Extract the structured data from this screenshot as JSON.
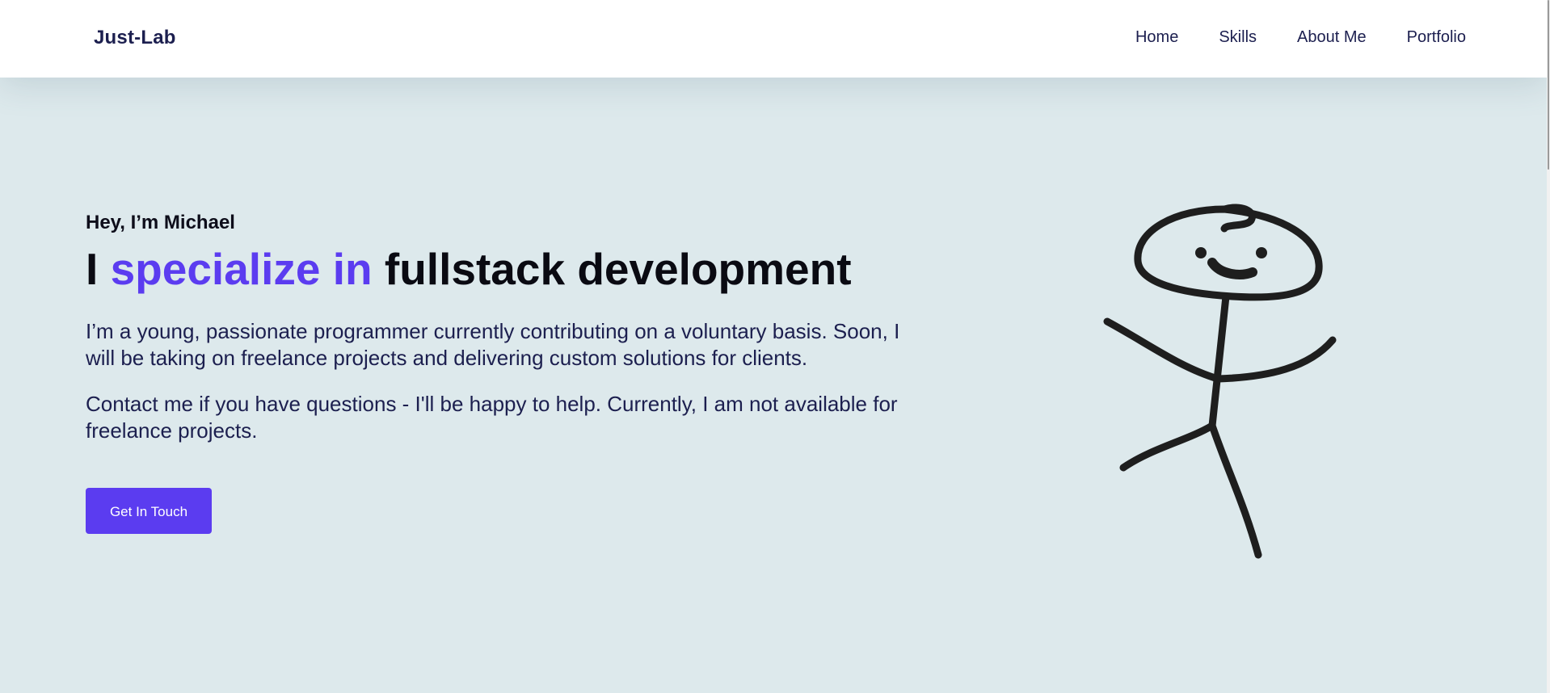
{
  "header": {
    "logo": "Just-Lab",
    "nav": [
      {
        "label": "Home"
      },
      {
        "label": "Skills"
      },
      {
        "label": "About Me"
      },
      {
        "label": "Portfolio"
      }
    ]
  },
  "hero": {
    "greeting": "Hey, I’m Michael",
    "headline": {
      "part1": "I ",
      "accent": "specialize in",
      "part2": " fullstack development"
    },
    "paragraph1": "I’m a young, passionate programmer currently contributing on a voluntary basis. Soon, I will be taking on freelance projects and delivering custom solutions for clients.",
    "paragraph2": "Contact me if you have questions - I'll be happy to help. Currently, I am not available for freelance projects.",
    "cta_label": "Get In Touch"
  },
  "illustration": {
    "icon": "stick-figure-drawing"
  },
  "colors": {
    "accent": "#5b3cf0",
    "background": "#dde9ec",
    "text_dark": "#1c1f4f"
  }
}
